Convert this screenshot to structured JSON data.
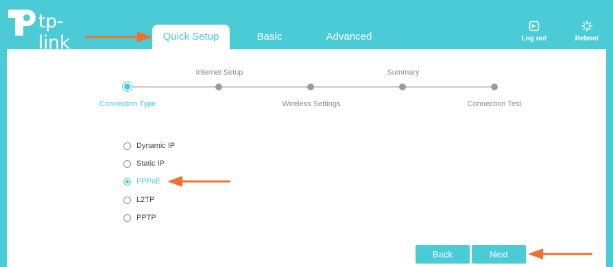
{
  "header": {
    "logo_text": "tp-link",
    "tabs": [
      {
        "label": "Quick Setup",
        "active": true
      },
      {
        "label": "Basic",
        "active": false
      },
      {
        "label": "Advanced",
        "active": false
      }
    ],
    "logout_label": "Log out",
    "reboot_label": "Reboot"
  },
  "wizard": {
    "steps": [
      {
        "label": "Connection Type",
        "current": true
      },
      {
        "label": "Internet Setup",
        "current": false
      },
      {
        "label": "Wireless Settings",
        "current": false
      },
      {
        "label": "Summary",
        "current": false
      },
      {
        "label": "Connection Test",
        "current": false
      }
    ]
  },
  "connection_types": {
    "options": [
      {
        "label": "Dynamic IP",
        "checked": false
      },
      {
        "label": "Static IP",
        "checked": false
      },
      {
        "label": "PPPoE",
        "checked": true
      },
      {
        "label": "L2TP",
        "checked": false
      },
      {
        "label": "PPTP",
        "checked": false
      }
    ]
  },
  "actions": {
    "back_label": "Back",
    "next_label": "Next"
  },
  "colors": {
    "brand": "#4acbd6",
    "annotation_arrow": "#f07030"
  },
  "icons": [
    "tp-link-logo-icon",
    "logout-icon",
    "reboot-icon",
    "annotation-arrow-icon"
  ]
}
